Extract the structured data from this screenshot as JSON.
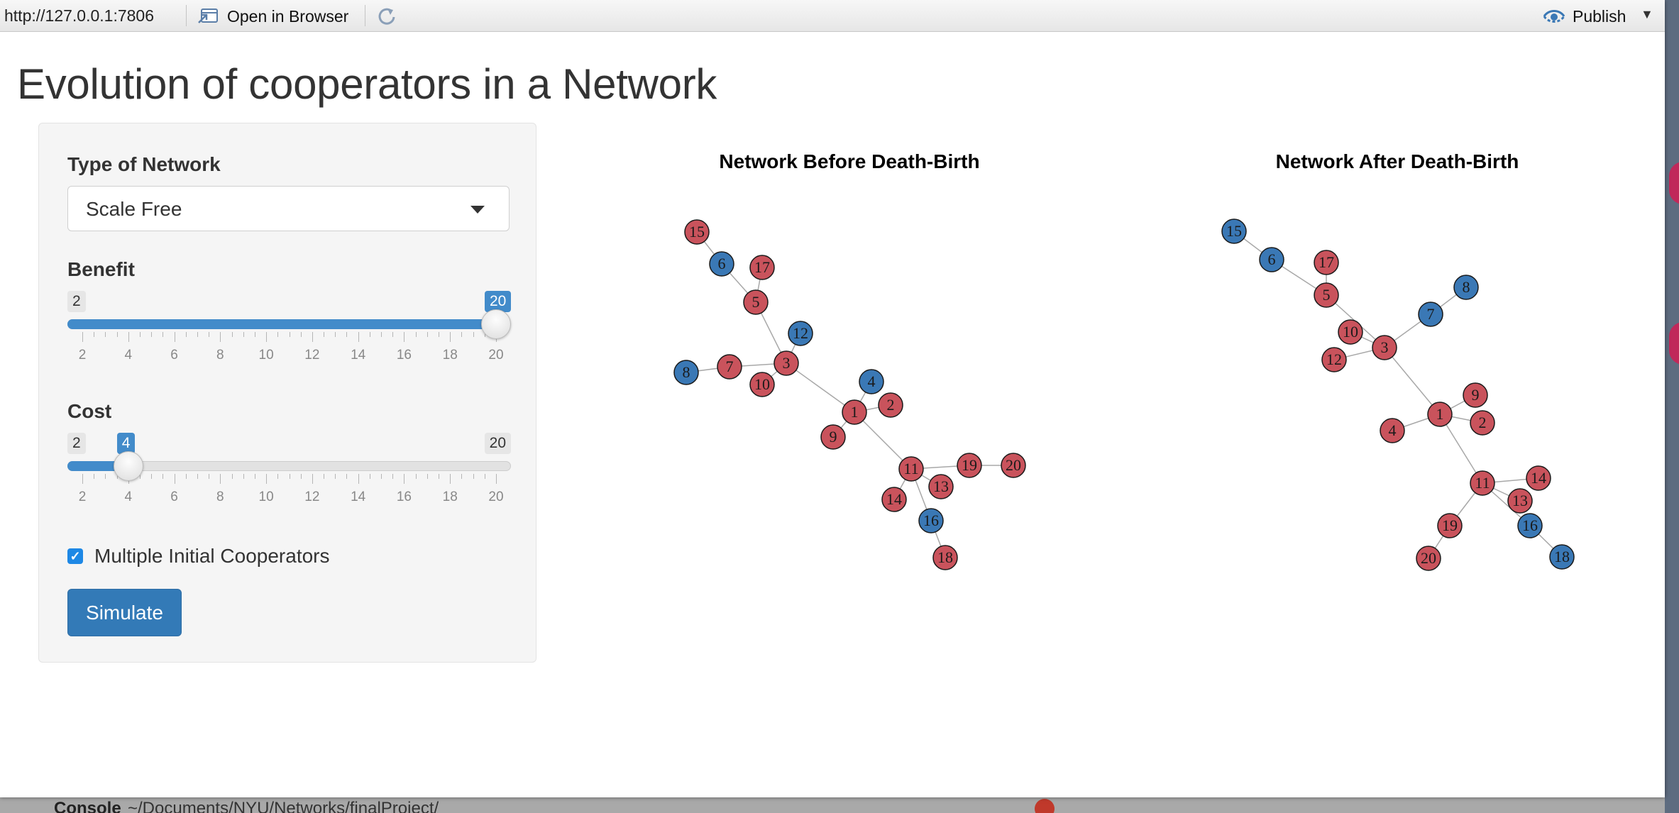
{
  "toolbar": {
    "url": "http://127.0.0.1:7806",
    "open_in_browser": "Open in Browser",
    "publish": "Publish"
  },
  "app": {
    "title": "Evolution of cooperators in a Network"
  },
  "sidebar": {
    "network_type_label": "Type of Network",
    "network_type_value": "Scale Free",
    "benefit": {
      "label": "Benefit",
      "min": 2,
      "max": 20,
      "value": 20,
      "ticks": [
        "2",
        "4",
        "6",
        "8",
        "10",
        "12",
        "14",
        "16",
        "18",
        "20"
      ]
    },
    "cost": {
      "label": "Cost",
      "min": 2,
      "max": 20,
      "value": 4,
      "ticks": [
        "2",
        "4",
        "6",
        "8",
        "10",
        "12",
        "14",
        "16",
        "18",
        "20"
      ]
    },
    "multiple_initial_cooperators": {
      "label": "Multiple Initial Cooperators",
      "checked": true
    },
    "simulate_label": "Simulate"
  },
  "colors": {
    "cooperator": "#3a78b5",
    "defector": "#c9535c",
    "accent": "#428bca",
    "edge": "#a8a8a8"
  },
  "plots": {
    "before": {
      "title": "Network Before Death-Birth",
      "edges": [
        [
          "15",
          "6"
        ],
        [
          "6",
          "5"
        ],
        [
          "17",
          "5"
        ],
        [
          "5",
          "3"
        ],
        [
          "12",
          "3"
        ],
        [
          "8",
          "7"
        ],
        [
          "7",
          "3"
        ],
        [
          "10",
          "3"
        ],
        [
          "3",
          "1"
        ],
        [
          "4",
          "1"
        ],
        [
          "2",
          "1"
        ],
        [
          "9",
          "1"
        ],
        [
          "1",
          "11"
        ],
        [
          "11",
          "19"
        ],
        [
          "19",
          "20"
        ],
        [
          "11",
          "14"
        ],
        [
          "11",
          "13"
        ],
        [
          "11",
          "16"
        ],
        [
          "16",
          "18"
        ]
      ],
      "nodes": [
        {
          "id": "15",
          "type": "defector"
        },
        {
          "id": "6",
          "type": "cooperator"
        },
        {
          "id": "17",
          "type": "defector"
        },
        {
          "id": "5",
          "type": "defector"
        },
        {
          "id": "12",
          "type": "cooperator"
        },
        {
          "id": "8",
          "type": "cooperator"
        },
        {
          "id": "7",
          "type": "defector"
        },
        {
          "id": "3",
          "type": "defector"
        },
        {
          "id": "10",
          "type": "defector"
        },
        {
          "id": "4",
          "type": "cooperator"
        },
        {
          "id": "2",
          "type": "defector"
        },
        {
          "id": "1",
          "type": "defector"
        },
        {
          "id": "9",
          "type": "defector"
        },
        {
          "id": "11",
          "type": "defector"
        },
        {
          "id": "19",
          "type": "defector"
        },
        {
          "id": "20",
          "type": "defector"
        },
        {
          "id": "14",
          "type": "defector"
        },
        {
          "id": "13",
          "type": "defector"
        },
        {
          "id": "16",
          "type": "cooperator"
        },
        {
          "id": "18",
          "type": "defector"
        }
      ]
    },
    "after": {
      "title": "Network After Death-Birth",
      "edges": [
        [
          "15",
          "6"
        ],
        [
          "6",
          "5"
        ],
        [
          "17",
          "5"
        ],
        [
          "5",
          "3"
        ],
        [
          "10",
          "3"
        ],
        [
          "12",
          "3"
        ],
        [
          "3",
          "7"
        ],
        [
          "7",
          "8"
        ],
        [
          "3",
          "1"
        ],
        [
          "9",
          "1"
        ],
        [
          "2",
          "1"
        ],
        [
          "4",
          "1"
        ],
        [
          "1",
          "11"
        ],
        [
          "11",
          "14"
        ],
        [
          "11",
          "13"
        ],
        [
          "11",
          "19"
        ],
        [
          "19",
          "20"
        ],
        [
          "11",
          "16"
        ],
        [
          "16",
          "18"
        ]
      ],
      "nodes": [
        {
          "id": "15",
          "type": "cooperator"
        },
        {
          "id": "6",
          "type": "cooperator"
        },
        {
          "id": "17",
          "type": "defector"
        },
        {
          "id": "5",
          "type": "defector"
        },
        {
          "id": "8",
          "type": "cooperator"
        },
        {
          "id": "7",
          "type": "cooperator"
        },
        {
          "id": "10",
          "type": "defector"
        },
        {
          "id": "3",
          "type": "defector"
        },
        {
          "id": "12",
          "type": "defector"
        },
        {
          "id": "9",
          "type": "defector"
        },
        {
          "id": "1",
          "type": "defector"
        },
        {
          "id": "2",
          "type": "defector"
        },
        {
          "id": "4",
          "type": "defector"
        },
        {
          "id": "11",
          "type": "defector"
        },
        {
          "id": "14",
          "type": "defector"
        },
        {
          "id": "13",
          "type": "defector"
        },
        {
          "id": "19",
          "type": "defector"
        },
        {
          "id": "16",
          "type": "cooperator"
        },
        {
          "id": "20",
          "type": "defector"
        },
        {
          "id": "18",
          "type": "cooperator"
        }
      ]
    }
  },
  "background": {
    "console_label": "Console",
    "console_path": "~/Documents/NYU/Networks/finalProject/"
  }
}
